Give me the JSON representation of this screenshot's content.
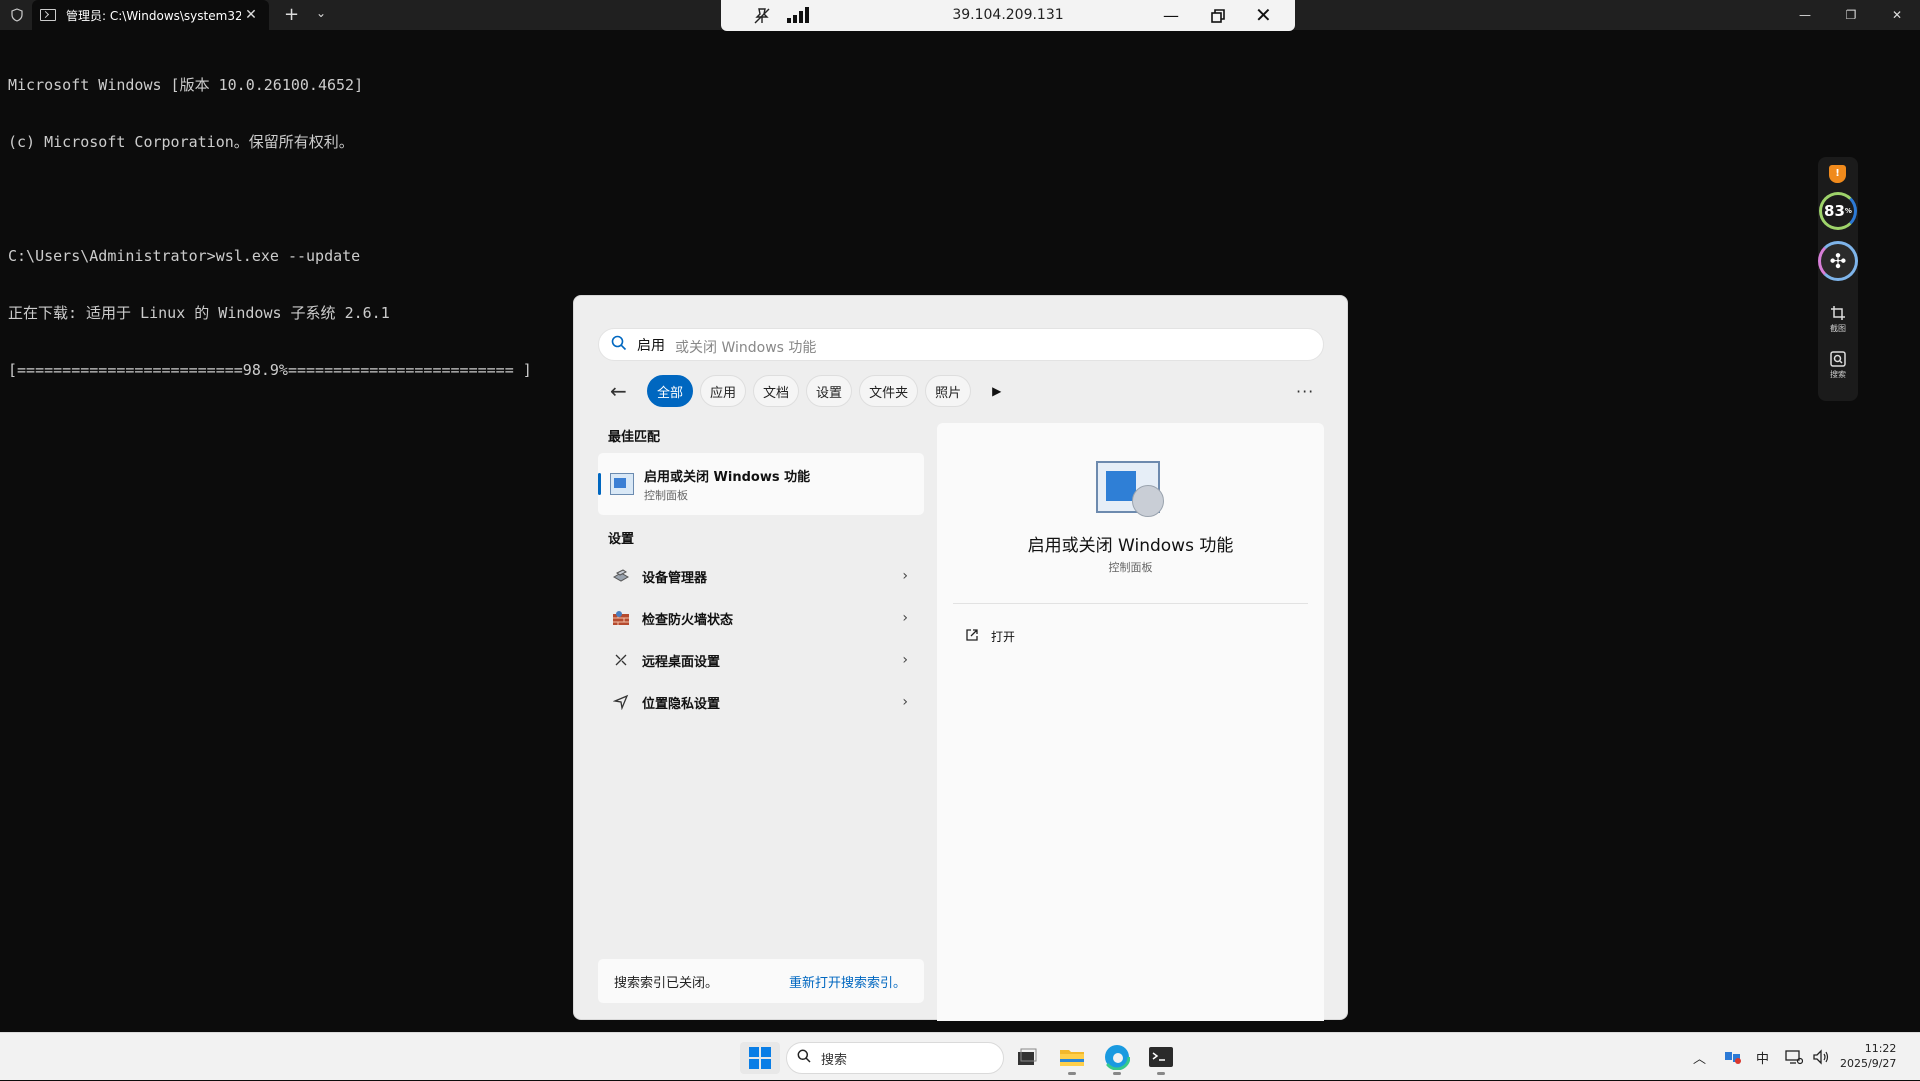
{
  "terminal": {
    "tab_title": "管理员: C:\\Windows\\system32",
    "tab_close": "✕",
    "new_tab": "+",
    "dropdown": "⌄",
    "lines": [
      "Microsoft Windows [版本 10.0.26100.4652]",
      "(c) Microsoft Corporation。保留所有权利。",
      "",
      "C:\\Users\\Administrator>wsl.exe --update",
      "正在下载: 适用于 Linux 的 Windows 子系统 2.6.1",
      "[=========================98.9%========================= ]"
    ],
    "window_controls": [
      "—",
      "❐",
      "✕"
    ]
  },
  "remote_bar": {
    "ip": "39.104.209.131",
    "minimize": "—",
    "close": "✕"
  },
  "side_widget": {
    "badge": "!",
    "score": "83",
    "score_unit": "%",
    "fan_label": "✣",
    "screenshot_label": "截图",
    "search_label": "搜索"
  },
  "search_panel": {
    "query": "启用",
    "placeholder": "启用或关闭 Windows 功能",
    "filters": [
      "全部",
      "应用",
      "文档",
      "设置",
      "文件夹",
      "照片"
    ],
    "active_filter": "全部",
    "more": "···",
    "best_match_header": "最佳匹配",
    "best_match": {
      "title": "启用或关闭 Windows 功能",
      "subtitle": "控制面板"
    },
    "settings_header": "设置",
    "settings_items": [
      {
        "label": "设备管理器",
        "icon": "device-manager-icon"
      },
      {
        "label": "检查防火墙状态",
        "icon": "firewall-icon"
      },
      {
        "label": "远程桌面设置",
        "icon": "remote-desktop-icon"
      },
      {
        "label": "位置隐私设置",
        "icon": "location-icon"
      }
    ],
    "index_notice": "搜索索引已关闭。",
    "index_link": "重新打开搜索索引。",
    "detail": {
      "title": "启用或关闭 Windows 功能",
      "subtitle": "控制面板",
      "open_label": "打开"
    }
  },
  "taskbar": {
    "search_label": "搜索",
    "ime": "中",
    "time": "11:22",
    "date": "2025/9/27"
  },
  "colors": {
    "accent": "#0067c0",
    "terminal_bg": "#0c0c0c",
    "terminal_text": "#cccccc"
  }
}
